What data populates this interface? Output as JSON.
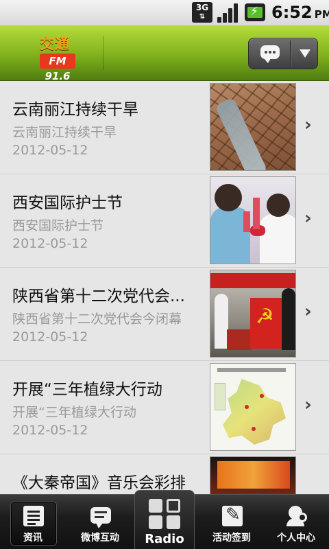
{
  "status_bar": {
    "network": "3G",
    "time": "6:52",
    "ampm": "PM"
  },
  "header": {
    "logo_top": "交通",
    "logo_bottom": "FM 91.6",
    "message_icon": "chat-bubble-icon",
    "dropdown_icon": "caret-down-icon"
  },
  "news": [
    {
      "title": "云南丽江持续干旱",
      "subtitle": "云南丽江持续干旱",
      "date": "2012-05-12"
    },
    {
      "title": "西安国际护士节",
      "subtitle": "西安国际护士节",
      "date": "2012-05-12"
    },
    {
      "title": "陕西省第十二次党代会...",
      "subtitle": "陕西省第十二次党代会今闭幕",
      "date": "2012-05-12"
    },
    {
      "title": "开展“三年植绿大行动",
      "subtitle": "开展“三年植绿大行动",
      "date": "2012-05-12"
    },
    {
      "title": "《大秦帝国》音乐会彩排",
      "subtitle": "",
      "date": ""
    }
  ],
  "tabs": [
    {
      "label": "资讯",
      "icon": "document-icon",
      "active": true
    },
    {
      "label": "微博互动",
      "icon": "chat-icon",
      "active": false
    },
    {
      "label": "Radio",
      "icon": "grid-icon",
      "active": false
    },
    {
      "label": "活动签到",
      "icon": "edit-icon",
      "active": false
    },
    {
      "label": "个人中心",
      "icon": "user-search-icon",
      "active": false
    }
  ],
  "colors": {
    "header_green": "#7fb01c",
    "logo_orange": "#f5a21a",
    "logo_red": "#e8371e",
    "list_bg": "#e6e6e6",
    "tabbar_bg": "#1d1d1d"
  }
}
